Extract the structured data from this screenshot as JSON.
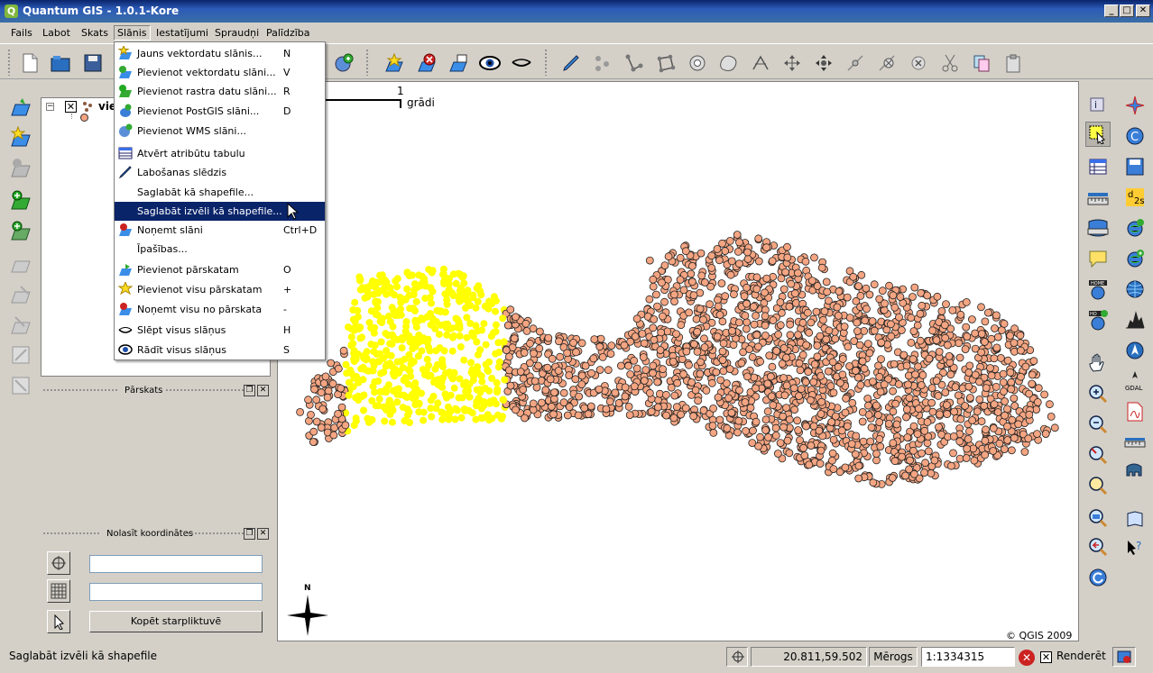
{
  "window": {
    "title": "Quantum GIS - 1.0.1-Kore",
    "app_icon": "Q"
  },
  "menubar": {
    "items": [
      {
        "label": "Fails"
      },
      {
        "label": "Labot"
      },
      {
        "label": "Skats"
      },
      {
        "label": "Slānis"
      },
      {
        "label": "Iestatījumi"
      },
      {
        "label": "Spraudņi"
      },
      {
        "label": "Palīdzība"
      }
    ],
    "active_index": 3
  },
  "layer_menu": {
    "items": [
      {
        "label": "Jauns vektordatu slānis...",
        "shortcut": "N",
        "icon": "new-vector-layer-icon"
      },
      {
        "label": "Pievienot vektordatu slāni...",
        "shortcut": "V",
        "icon": "add-vector-layer-icon"
      },
      {
        "label": "Pievienot rastra datu slāni...",
        "shortcut": "R",
        "icon": "add-raster-layer-icon"
      },
      {
        "label": "Pievienot PostGIS slāni...",
        "shortcut": "D",
        "icon": "add-postgis-layer-icon"
      },
      {
        "label": "Pievienot WMS slāni...",
        "shortcut": "",
        "icon": "add-wms-layer-icon"
      },
      {
        "label": "Atvērt atribūtu tabulu",
        "shortcut": "",
        "icon": "attribute-table-icon"
      },
      {
        "label": "Labošanas slēdzis",
        "shortcut": "",
        "icon": "toggle-editing-icon"
      },
      {
        "label": "Saglabāt kā shapefile...",
        "shortcut": "",
        "icon": ""
      },
      {
        "label": "Saglabāt izvēli kā shapefile...",
        "shortcut": "",
        "icon": ""
      },
      {
        "label": "Noņemt slāni",
        "shortcut": "Ctrl+D",
        "icon": "remove-layer-icon"
      },
      {
        "label": "Īpašības...",
        "shortcut": "",
        "icon": ""
      },
      {
        "label": "Pievienot pārskatam",
        "shortcut": "O",
        "icon": "add-to-overview-icon"
      },
      {
        "label": "Pievienot visu pārskatam",
        "shortcut": "+",
        "icon": "add-all-to-overview-icon"
      },
      {
        "label": "Noņemt visu no pārskata",
        "shortcut": "-",
        "icon": "remove-all-from-overview-icon"
      },
      {
        "label": "Slēpt visus slāņus",
        "shortcut": "H",
        "icon": "hide-all-layers-icon"
      },
      {
        "label": "Rādīt visus slāņus",
        "shortcut": "S",
        "icon": "show-all-layers-icon"
      }
    ],
    "highlighted_index": 8
  },
  "layers_panel": {
    "layer_name": "vie"
  },
  "overview_panel": {
    "title": "Pārskats"
  },
  "coords_panel": {
    "title": "Nolasīt koordinātes",
    "field1_value": "",
    "field2_value": "",
    "copy_button_label": "Kopēt starpliktuvē"
  },
  "map": {
    "scalebar_value": "1",
    "scalebar_unit": "grādi",
    "north_label": "N",
    "copyright": "© QGIS 2009",
    "selected_color": "#ffff00",
    "point_color": "#f4a582"
  },
  "statusbar": {
    "message": "Saglabāt izvēli kā shapefile",
    "coordinates": "20.811,59.502",
    "scale_label": "Mērogs",
    "scale_value": "1:1334315",
    "render_label": "Renderēt"
  }
}
